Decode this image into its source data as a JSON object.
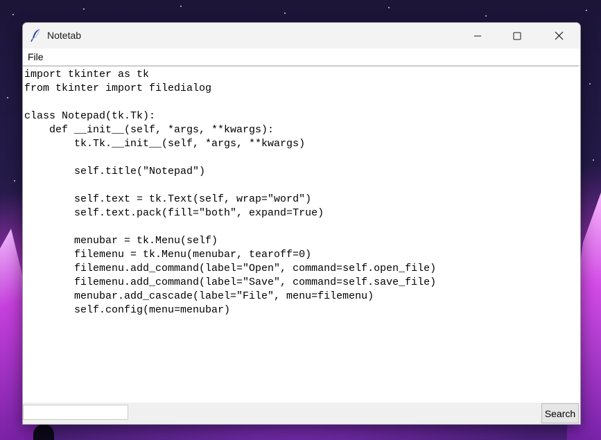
{
  "window": {
    "title": "Notetab",
    "controls": {
      "minimize_icon": "minimize-icon",
      "maximize_icon": "maximize-icon",
      "close_icon": "close-icon"
    }
  },
  "menubar": {
    "items": [
      {
        "label": "File"
      }
    ]
  },
  "editor": {
    "lines": [
      "import tkinter as tk",
      "from tkinter import filedialog",
      "",
      "class Notepad(tk.Tk):",
      "    def __init__(self, *args, **kwargs):",
      "        tk.Tk.__init__(self, *args, **kwargs)",
      "",
      "        self.title(\"Notepad\")",
      "",
      "        self.text = tk.Text(self, wrap=\"word\")",
      "        self.text.pack(fill=\"both\", expand=True)",
      "",
      "        menubar = tk.Menu(self)",
      "        filemenu = tk.Menu(menubar, tearoff=0)",
      "        filemenu.add_command(label=\"Open\", command=self.open_file)",
      "        filemenu.add_command(label=\"Save\", command=self.save_file)",
      "        menubar.add_cascade(label=\"File\", menu=filemenu)",
      "        self.config(menu=menubar)"
    ]
  },
  "search": {
    "value": "",
    "button_label": "Search"
  },
  "colors": {
    "titlebar": "#f3f3f3",
    "editor_bg": "#ffffff",
    "bottombar": "#f0f0f0"
  }
}
